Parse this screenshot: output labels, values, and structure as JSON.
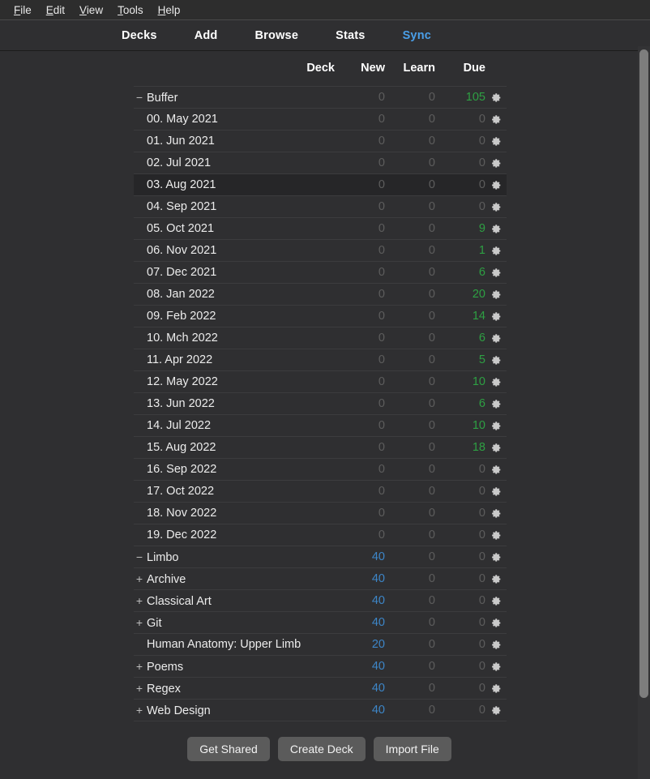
{
  "menubar": {
    "items": [
      {
        "accel": "F",
        "rest": "ile"
      },
      {
        "accel": "E",
        "rest": "dit"
      },
      {
        "accel": "V",
        "rest": "iew"
      },
      {
        "accel": "T",
        "rest": "ools"
      },
      {
        "accel": "H",
        "rest": "elp"
      }
    ]
  },
  "topnav": {
    "links": [
      {
        "label": "Decks",
        "active": false
      },
      {
        "label": "Add",
        "active": false
      },
      {
        "label": "Browse",
        "active": false
      },
      {
        "label": "Stats",
        "active": false
      },
      {
        "label": "Sync",
        "active": true
      }
    ]
  },
  "colors": {
    "background": "#2f2f31",
    "accent_blue": "#4a9fe8",
    "count_new": "#3d86c8",
    "count_due": "#2ea043",
    "count_zero": "#5d5d5d",
    "row_hover": "#262628"
  },
  "table": {
    "headers": {
      "deck": "Deck",
      "new": "New",
      "learn": "Learn",
      "due": "Due"
    },
    "gear_icon": "gear-icon",
    "rows": [
      {
        "name": "Buffer",
        "level": 0,
        "toggle": "−",
        "new": "0",
        "learn": "0",
        "due": "105",
        "hovered": false
      },
      {
        "name": "00. May 2021",
        "level": 1,
        "toggle": "",
        "new": "0",
        "learn": "0",
        "due": "0",
        "hovered": false
      },
      {
        "name": "01. Jun 2021",
        "level": 1,
        "toggle": "",
        "new": "0",
        "learn": "0",
        "due": "0",
        "hovered": false
      },
      {
        "name": "02. Jul 2021",
        "level": 1,
        "toggle": "",
        "new": "0",
        "learn": "0",
        "due": "0",
        "hovered": false
      },
      {
        "name": "03. Aug 2021",
        "level": 1,
        "toggle": "",
        "new": "0",
        "learn": "0",
        "due": "0",
        "hovered": true
      },
      {
        "name": "04. Sep 2021",
        "level": 1,
        "toggle": "",
        "new": "0",
        "learn": "0",
        "due": "0",
        "hovered": false
      },
      {
        "name": "05. Oct 2021",
        "level": 1,
        "toggle": "",
        "new": "0",
        "learn": "0",
        "due": "9",
        "hovered": false
      },
      {
        "name": "06. Nov 2021",
        "level": 1,
        "toggle": "",
        "new": "0",
        "learn": "0",
        "due": "1",
        "hovered": false
      },
      {
        "name": "07. Dec 2021",
        "level": 1,
        "toggle": "",
        "new": "0",
        "learn": "0",
        "due": "6",
        "hovered": false
      },
      {
        "name": "08. Jan 2022",
        "level": 1,
        "toggle": "",
        "new": "0",
        "learn": "0",
        "due": "20",
        "hovered": false
      },
      {
        "name": "09. Feb 2022",
        "level": 1,
        "toggle": "",
        "new": "0",
        "learn": "0",
        "due": "14",
        "hovered": false
      },
      {
        "name": "10. Mch 2022",
        "level": 1,
        "toggle": "",
        "new": "0",
        "learn": "0",
        "due": "6",
        "hovered": false
      },
      {
        "name": "11. Apr 2022",
        "level": 1,
        "toggle": "",
        "new": "0",
        "learn": "0",
        "due": "5",
        "hovered": false
      },
      {
        "name": "12. May 2022",
        "level": 1,
        "toggle": "",
        "new": "0",
        "learn": "0",
        "due": "10",
        "hovered": false
      },
      {
        "name": "13. Jun 2022",
        "level": 1,
        "toggle": "",
        "new": "0",
        "learn": "0",
        "due": "6",
        "hovered": false
      },
      {
        "name": "14. Jul 2022",
        "level": 1,
        "toggle": "",
        "new": "0",
        "learn": "0",
        "due": "10",
        "hovered": false
      },
      {
        "name": "15. Aug 2022",
        "level": 1,
        "toggle": "",
        "new": "0",
        "learn": "0",
        "due": "18",
        "hovered": false
      },
      {
        "name": "16. Sep 2022",
        "level": 1,
        "toggle": "",
        "new": "0",
        "learn": "0",
        "due": "0",
        "hovered": false
      },
      {
        "name": "17. Oct 2022",
        "level": 1,
        "toggle": "",
        "new": "0",
        "learn": "0",
        "due": "0",
        "hovered": false
      },
      {
        "name": "18. Nov 2022",
        "level": 1,
        "toggle": "",
        "new": "0",
        "learn": "0",
        "due": "0",
        "hovered": false
      },
      {
        "name": "19. Dec 2022",
        "level": 1,
        "toggle": "",
        "new": "0",
        "learn": "0",
        "due": "0",
        "hovered": false
      },
      {
        "name": "Limbo",
        "level": 0,
        "toggle": "−",
        "new": "40",
        "learn": "0",
        "due": "0",
        "hovered": false
      },
      {
        "name": "Archive",
        "level": 1,
        "toggle": "+",
        "new": "40",
        "learn": "0",
        "due": "0",
        "hovered": false
      },
      {
        "name": "Classical Art",
        "level": 1,
        "toggle": "+",
        "new": "40",
        "learn": "0",
        "due": "0",
        "hovered": false
      },
      {
        "name": "Git",
        "level": 1,
        "toggle": "+",
        "new": "40",
        "learn": "0",
        "due": "0",
        "hovered": false
      },
      {
        "name": "Human Anatomy: Upper Limb",
        "level": 1,
        "toggle": "",
        "new": "20",
        "learn": "0",
        "due": "0",
        "hovered": false
      },
      {
        "name": "Poems",
        "level": 1,
        "toggle": "+",
        "new": "40",
        "learn": "0",
        "due": "0",
        "hovered": false
      },
      {
        "name": "Regex",
        "level": 1,
        "toggle": "+",
        "new": "40",
        "learn": "0",
        "due": "0",
        "hovered": false
      },
      {
        "name": "Web Design",
        "level": 1,
        "toggle": "+",
        "new": "40",
        "learn": "0",
        "due": "0",
        "hovered": false
      }
    ]
  },
  "buttons": {
    "get_shared": "Get Shared",
    "create_deck": "Create Deck",
    "import_file": "Import File"
  }
}
